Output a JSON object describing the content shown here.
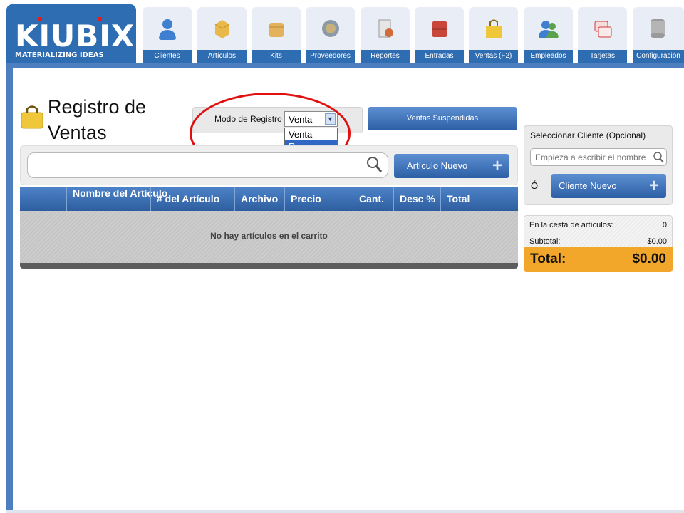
{
  "logo": {
    "text": "KIUBIX",
    "tagline": "MATERIALIZING IDEAS"
  },
  "nav": [
    {
      "label": "Clientes",
      "icon": "person-icon",
      "color": "#3f7fd0"
    },
    {
      "label": "Artículos",
      "icon": "box-open-icon",
      "color": "#e8b84a"
    },
    {
      "label": "Kits",
      "icon": "package-icon",
      "color": "#e4b25a"
    },
    {
      "label": "Proveedores",
      "icon": "supplier-globe-icon",
      "color": "#8c9aa8"
    },
    {
      "label": "Reportes",
      "icon": "report-chart-icon",
      "color": "#d26b3a"
    },
    {
      "label": "Entradas",
      "icon": "crates-icon",
      "color": "#c8473a"
    },
    {
      "label": "Ventas (F2)",
      "icon": "shopping-bag-icon",
      "color": "#f0c63a"
    },
    {
      "label": "Empleados",
      "icon": "users-icon",
      "color": "#5aa34a"
    },
    {
      "label": "Tarjetas",
      "icon": "cards-icon",
      "color": "#d33b3b"
    },
    {
      "label": "Configuración",
      "icon": "database-icon",
      "color": "#9a9a9a"
    }
  ],
  "page": {
    "title": "Registro de Ventas"
  },
  "mode": {
    "label": "Modo de Registro",
    "selected": "Venta",
    "options": [
      "Venta",
      "Regresar"
    ],
    "highlighted": "Regresar"
  },
  "suspended_button": "Ventas Suspendidas",
  "search": {
    "value": "",
    "placeholder": ""
  },
  "new_item_button": "Artículo Nuevo",
  "table": {
    "columns": [
      "",
      "Nombre del Artículo",
      "# del Artículo",
      "Archivo",
      "Precio",
      "Cant.",
      "Desc %",
      "Total"
    ],
    "empty_message": "No hay artículos en el carrito"
  },
  "customer": {
    "title": "Seleccionar Cliente (Opcional)",
    "placeholder": "Empieza a escribir el nombre",
    "or_label": "Ó",
    "new_button": "Cliente Nuevo"
  },
  "summary": {
    "items_label": "En la cesta de artículos:",
    "items_value": "0",
    "subtotal_label": "Subtotal:",
    "subtotal_value": "$0.00",
    "total_label": "Total:",
    "total_value": "$0.00"
  },
  "colors": {
    "brand_blue": "#2f6db3",
    "total_orange": "#f3a72a",
    "highlight_red": "#e01010"
  }
}
